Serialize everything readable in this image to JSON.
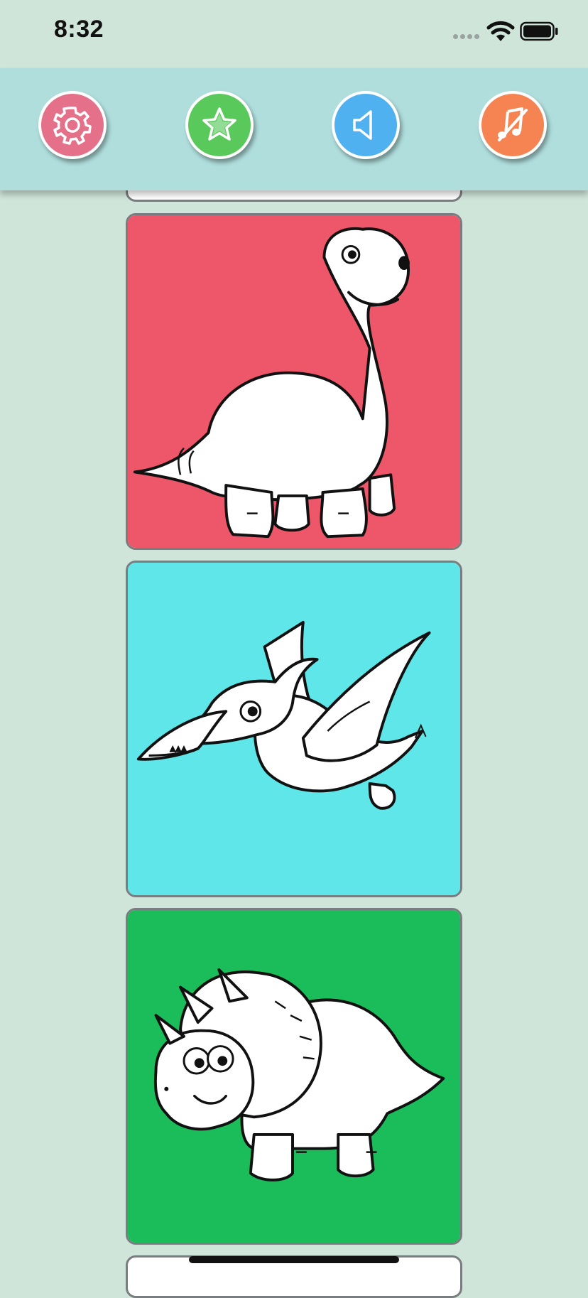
{
  "status_bar": {
    "time": "8:32"
  },
  "toolbar": {
    "buttons": [
      {
        "name": "settings",
        "icon": "gear-icon",
        "color": "#e57089"
      },
      {
        "name": "favorites",
        "icon": "star-icon",
        "color": "#5ac95c"
      },
      {
        "name": "sound",
        "icon": "speaker-icon",
        "color": "#4fb1ef"
      },
      {
        "name": "music",
        "icon": "music-off-icon",
        "color": "#f58452"
      }
    ]
  },
  "gallery": {
    "cards": [
      {
        "subject": "brontosaurus-drawing",
        "background": "#ee5769"
      },
      {
        "subject": "pterodactyl-drawing",
        "background": "#5ee6e9"
      },
      {
        "subject": "triceratops-drawing",
        "background": "#1bbd5b"
      }
    ]
  },
  "colors": {
    "page_background": "#d0e5da",
    "toolbar_background": "#afdedd"
  }
}
